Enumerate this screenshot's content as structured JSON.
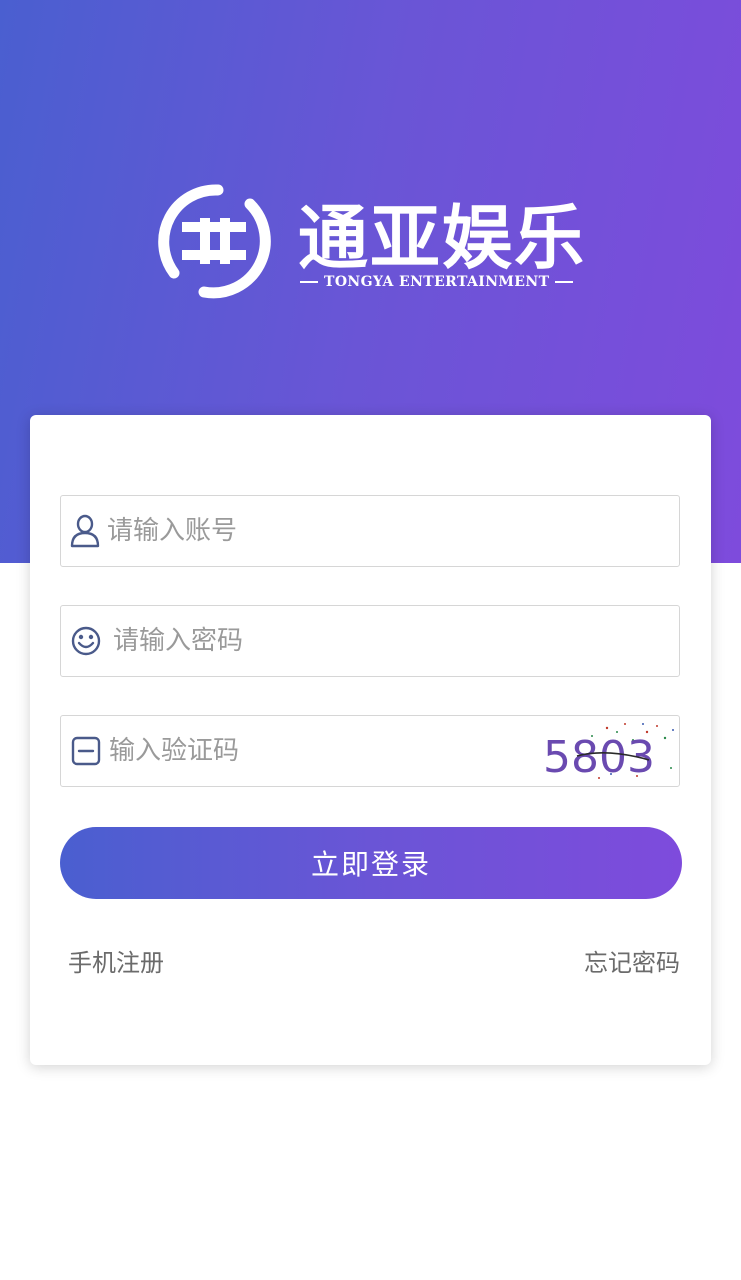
{
  "brand": {
    "name": "通亚娱乐",
    "subtitle": "TONGYA ENTERTAINMENT",
    "primary_color": "#4a5fd0",
    "secondary_color": "#7e4bdc"
  },
  "form": {
    "username": {
      "placeholder": "请输入账号",
      "value": "",
      "icon": "user-icon"
    },
    "password": {
      "placeholder": "请输入密码",
      "value": "",
      "icon": "smiley-icon"
    },
    "captcha": {
      "placeholder": "输入验证码",
      "value": "",
      "icon": "minus-box-icon",
      "image_text": "5803"
    },
    "login_label": "立即登录"
  },
  "links": {
    "register": "手机注册",
    "forgot_password": "忘记密码"
  }
}
